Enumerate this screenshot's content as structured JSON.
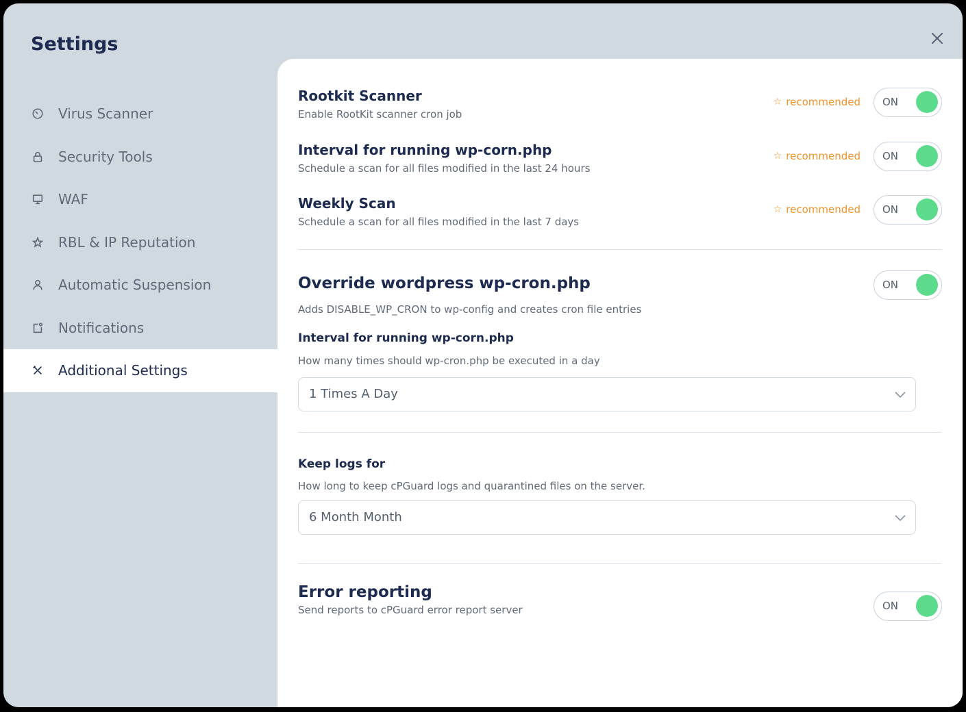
{
  "window": {
    "title": "Settings"
  },
  "sidebar": {
    "items": [
      {
        "label": "Virus Scanner",
        "icon": "gauge-icon"
      },
      {
        "label": "Security Tools",
        "icon": "lock-icon"
      },
      {
        "label": "WAF",
        "icon": "monitor-icon"
      },
      {
        "label": "RBL & IP Reputation",
        "icon": "star-icon"
      },
      {
        "label": "Automatic Suspension",
        "icon": "user-icon"
      },
      {
        "label": "Notifications",
        "icon": "notification-icon"
      },
      {
        "label": "Additional Settings",
        "icon": "tools-icon",
        "active": true
      }
    ]
  },
  "settings": {
    "rootkit": {
      "title": "Rootkit Scanner",
      "desc": "Enable RootKit scanner cron job",
      "badge": "recommended",
      "toggle": "ON"
    },
    "interval": {
      "title": "Interval for running wp-corn.php",
      "desc": "Schedule a scan for all files modified in the last 24 hours",
      "badge": "recommended",
      "toggle": "ON"
    },
    "weekly": {
      "title": "Weekly Scan",
      "desc": "Schedule a scan for all files modified in the last 7 days",
      "badge": "recommended",
      "toggle": "ON"
    },
    "override": {
      "title": "Override wordpress wp-cron.php",
      "toggle": "ON",
      "desc": "Adds DISABLE_WP_CRON to wp-config and creates cron file entries",
      "interval_label": "Interval for running wp-corn.php",
      "interval_desc": "How many times should wp-cron.php be executed in a day",
      "interval_value": "1 Times A Day"
    },
    "logs": {
      "title": "Keep logs for",
      "desc": "How long to keep cPGuard logs and quarantined files on the server.",
      "value": "6 Month Month"
    },
    "error": {
      "title": "Error reporting",
      "desc": "Send reports to cPGuard error report server",
      "toggle": "ON"
    }
  },
  "colors": {
    "accent_green": "#5cdb8d",
    "recommended_orange": "#f0932b",
    "heading": "#1c2b4f",
    "sidebar_bg": "#d1d9e0"
  }
}
